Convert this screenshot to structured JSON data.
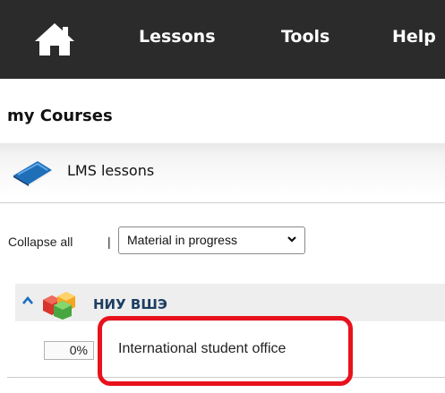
{
  "nav": {
    "items": [
      "Lessons",
      "Tools",
      "Help"
    ]
  },
  "page": {
    "title": "my Courses"
  },
  "lms": {
    "label": "LMS lessons"
  },
  "controls": {
    "collapse_label": "Collapse all",
    "separator": "|",
    "filter_value": "Material in progress"
  },
  "group": {
    "label": "НИУ ВШЭ",
    "items": [
      {
        "progress": "0%",
        "title": "International student office"
      }
    ]
  },
  "colors": {
    "topbar": "#2b2b2b",
    "highlight": "#e8121c",
    "group_link": "#1d3e63"
  },
  "icons": [
    "home-icon",
    "book-icon",
    "chevron-down-icon",
    "collapse-arrow-icon",
    "cubes-icon"
  ]
}
